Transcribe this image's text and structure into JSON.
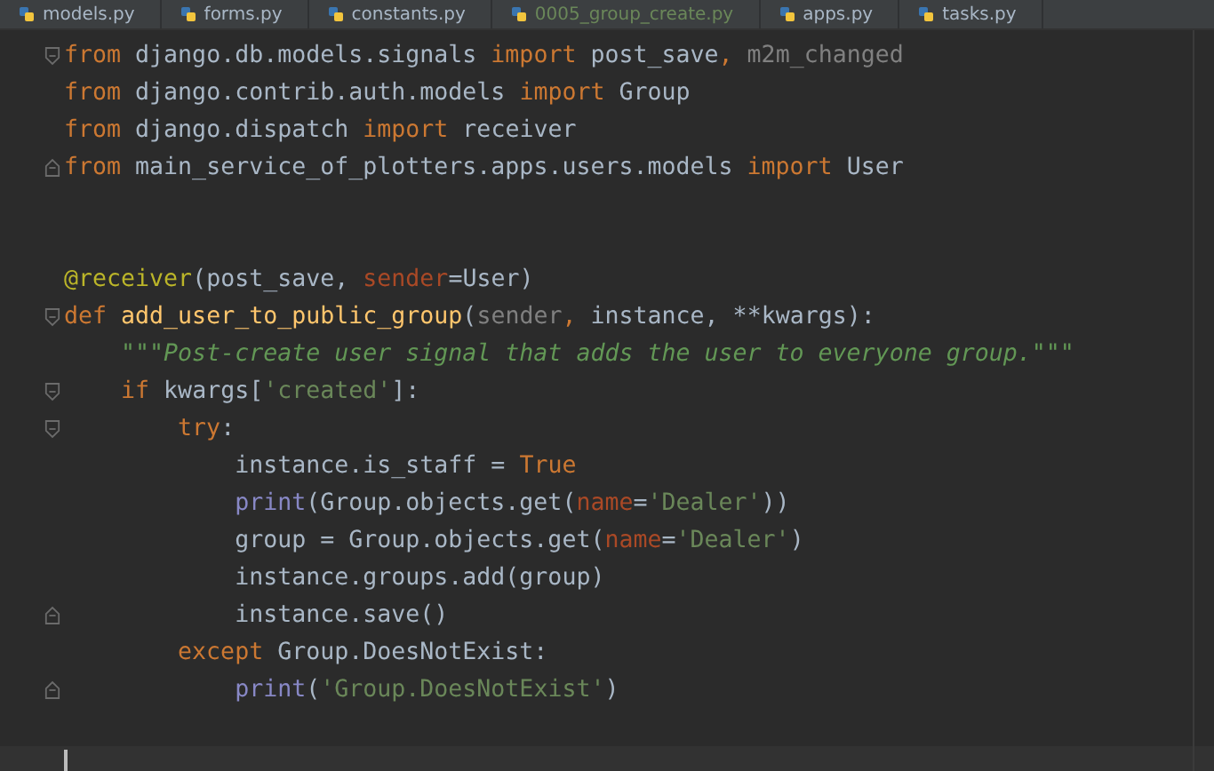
{
  "tabs": [
    {
      "label": "models.py",
      "selected": false,
      "modified": false
    },
    {
      "label": "forms.py",
      "selected": false,
      "modified": false
    },
    {
      "label": "constants.py",
      "selected": false,
      "modified": false
    },
    {
      "label": "0005_group_create.py",
      "selected": false,
      "modified": true
    },
    {
      "label": "apps.py",
      "selected": false,
      "modified": false
    },
    {
      "label": "tasks.py",
      "selected": false,
      "modified": false
    }
  ],
  "editor": {
    "lines": [
      {
        "fold_open": true,
        "fold_close": false,
        "current": false,
        "tokens": [
          {
            "kind": "kw",
            "text": "from"
          },
          {
            "kind": "plain",
            "text": " django.db.models.signals "
          },
          {
            "kind": "kw",
            "text": "import"
          },
          {
            "kind": "plain",
            "text": " post_save"
          },
          {
            "kind": "kw",
            "text": ","
          },
          {
            "kind": "dim",
            "text": " m2m_changed"
          }
        ]
      },
      {
        "fold_open": false,
        "fold_close": false,
        "current": false,
        "tokens": [
          {
            "kind": "kw",
            "text": "from"
          },
          {
            "kind": "plain",
            "text": " django.contrib.auth.models "
          },
          {
            "kind": "kw",
            "text": "import"
          },
          {
            "kind": "plain",
            "text": " Group"
          }
        ]
      },
      {
        "fold_open": false,
        "fold_close": false,
        "current": false,
        "tokens": [
          {
            "kind": "kw",
            "text": "from"
          },
          {
            "kind": "plain",
            "text": " django.dispatch "
          },
          {
            "kind": "kw",
            "text": "import"
          },
          {
            "kind": "plain",
            "text": " receiver"
          }
        ]
      },
      {
        "fold_open": false,
        "fold_close": true,
        "current": false,
        "tokens": [
          {
            "kind": "kw",
            "text": "from"
          },
          {
            "kind": "plain",
            "text": " main_service_of_plotters.apps.users.models "
          },
          {
            "kind": "kw",
            "text": "import"
          },
          {
            "kind": "plain",
            "text": " User"
          }
        ]
      },
      {
        "fold_open": false,
        "fold_close": false,
        "current": false
      },
      {
        "fold_open": false,
        "fold_close": false,
        "current": false
      },
      {
        "fold_open": false,
        "fold_close": false,
        "current": false,
        "tokens": [
          {
            "kind": "deco",
            "text": "@receiver"
          },
          {
            "kind": "plain",
            "text": "(post_save, "
          },
          {
            "kind": "param",
            "text": "sender"
          },
          {
            "kind": "plain",
            "text": "=User)"
          }
        ]
      },
      {
        "fold_open": true,
        "fold_close": false,
        "current": false,
        "tokens": [
          {
            "kind": "kw",
            "text": "def "
          },
          {
            "kind": "fn",
            "text": "add_user_to_public_group"
          },
          {
            "kind": "plain",
            "text": "("
          },
          {
            "kind": "dim",
            "text": "sender"
          },
          {
            "kind": "kw",
            "text": ","
          },
          {
            "kind": "plain",
            "text": " instance, **kwargs):"
          }
        ]
      },
      {
        "fold_open": false,
        "fold_close": false,
        "current": false,
        "tokens": [
          {
            "kind": "doc",
            "text": "    \"\"\"Post-create user signal that adds the user to everyone group.\"\"\""
          }
        ]
      },
      {
        "fold_open": true,
        "fold_close": false,
        "current": false,
        "tokens": [
          {
            "kind": "kw",
            "text": "    if"
          },
          {
            "kind": "plain",
            "text": " kwargs["
          },
          {
            "kind": "str",
            "text": "'created'"
          },
          {
            "kind": "plain",
            "text": "]:"
          }
        ]
      },
      {
        "fold_open": true,
        "fold_close": false,
        "current": false,
        "tokens": [
          {
            "kind": "kw",
            "text": "        try"
          },
          {
            "kind": "plain",
            "text": ":"
          }
        ]
      },
      {
        "fold_open": false,
        "fold_close": false,
        "current": false,
        "tokens": [
          {
            "kind": "plain",
            "text": "            instance.is_staff = "
          },
          {
            "kind": "kw",
            "text": "True"
          }
        ]
      },
      {
        "fold_open": false,
        "fold_close": false,
        "current": false,
        "tokens": [
          {
            "kind": "builtin",
            "text": "            print"
          },
          {
            "kind": "plain",
            "text": "(Group.objects.get("
          },
          {
            "kind": "param",
            "text": "name"
          },
          {
            "kind": "plain",
            "text": "="
          },
          {
            "kind": "str",
            "text": "'Dealer'"
          },
          {
            "kind": "plain",
            "text": "))"
          }
        ]
      },
      {
        "fold_open": false,
        "fold_close": false,
        "current": false,
        "tokens": [
          {
            "kind": "plain",
            "text": "            group = Group.objects.get("
          },
          {
            "kind": "param",
            "text": "name"
          },
          {
            "kind": "plain",
            "text": "="
          },
          {
            "kind": "str",
            "text": "'Dealer'"
          },
          {
            "kind": "plain",
            "text": ")"
          }
        ]
      },
      {
        "fold_open": false,
        "fold_close": false,
        "current": false,
        "tokens": [
          {
            "kind": "plain",
            "text": "            instance.groups.add(group)"
          }
        ]
      },
      {
        "fold_open": false,
        "fold_close": true,
        "current": false,
        "tokens": [
          {
            "kind": "plain",
            "text": "            instance.save()"
          }
        ]
      },
      {
        "fold_open": false,
        "fold_close": false,
        "current": false,
        "tokens": [
          {
            "kind": "kw",
            "text": "        except"
          },
          {
            "kind": "plain",
            "text": " Group.DoesNotExist:"
          }
        ]
      },
      {
        "fold_open": false,
        "fold_close": true,
        "current": false,
        "tokens": [
          {
            "kind": "builtin",
            "text": "            print"
          },
          {
            "kind": "plain",
            "text": "("
          },
          {
            "kind": "str",
            "text": "'Group.DoesNotExist'"
          },
          {
            "kind": "plain",
            "text": ")"
          }
        ]
      },
      {
        "fold_open": false,
        "fold_close": false,
        "current": false
      },
      {
        "fold_open": false,
        "fold_close": false,
        "current": true
      }
    ]
  }
}
